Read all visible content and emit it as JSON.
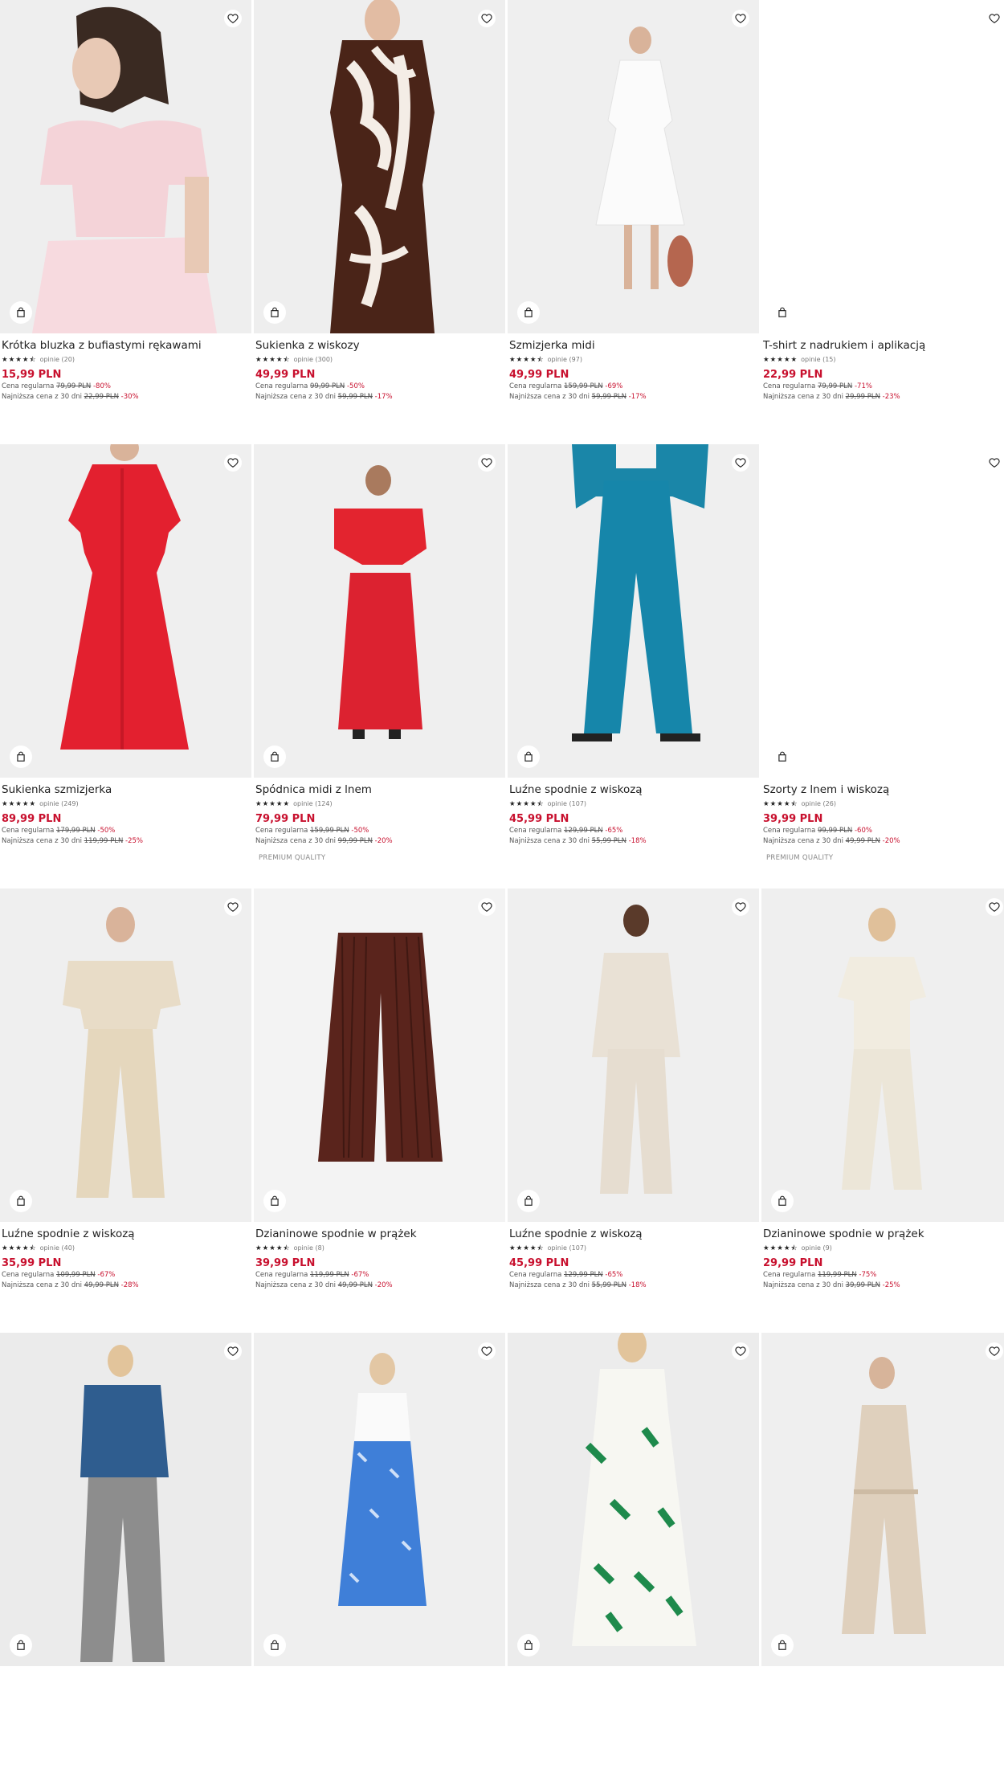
{
  "products": [
    {
      "title": "Krótka bluzka z bufiastymi rękawami",
      "stars": 4.5,
      "reviews": "opinie (20)",
      "price": "15,99 PLN",
      "regular_label": "Cena regularna",
      "regular_price": "79,99 PLN",
      "regular_discount": "-80%",
      "lowest_label": "Najniższa cena z 30 dni",
      "lowest_price": "22,99 PLN",
      "lowest_discount": "-30%",
      "premium": ""
    },
    {
      "title": "Sukienka z wiskozy",
      "stars": 4.5,
      "reviews": "opinie (300)",
      "price": "49,99 PLN",
      "regular_label": "Cena regularna",
      "regular_price": "99,99 PLN",
      "regular_discount": "-50%",
      "lowest_label": "Najniższa cena z 30 dni",
      "lowest_price": "59,99 PLN",
      "lowest_discount": "-17%",
      "premium": ""
    },
    {
      "title": "Szmizjerka midi",
      "stars": 4.5,
      "reviews": "opinie (97)",
      "price": "49,99 PLN",
      "regular_label": "Cena regularna",
      "regular_price": "159,99 PLN",
      "regular_discount": "-69%",
      "lowest_label": "Najniższa cena z 30 dni",
      "lowest_price": "59,99 PLN",
      "lowest_discount": "-17%",
      "premium": ""
    },
    {
      "title": "T-shirt z nadrukiem i aplikacją",
      "stars": 5,
      "reviews": "opinie (15)",
      "price": "22,99 PLN",
      "regular_label": "Cena regularna",
      "regular_price": "79,99 PLN",
      "regular_discount": "-71%",
      "lowest_label": "Najniższa cena z 30 dni",
      "lowest_price": "29,99 PLN",
      "lowest_discount": "-23%",
      "premium": ""
    },
    {
      "title": "Sukienka szmizjerka",
      "stars": 5,
      "reviews": "opinie (249)",
      "price": "89,99 PLN",
      "regular_label": "Cena regularna",
      "regular_price": "179,99 PLN",
      "regular_discount": "-50%",
      "lowest_label": "Najniższa cena z 30 dni",
      "lowest_price": "119,99 PLN",
      "lowest_discount": "-25%",
      "premium": ""
    },
    {
      "title": "Spódnica midi z lnem",
      "stars": 5,
      "reviews": "opinie (124)",
      "price": "79,99 PLN",
      "regular_label": "Cena regularna",
      "regular_price": "159,99 PLN",
      "regular_discount": "-50%",
      "lowest_label": "Najniższa cena z 30 dni",
      "lowest_price": "99,99 PLN",
      "lowest_discount": "-20%",
      "premium": "PREMIUM QUALITY"
    },
    {
      "title": "Luźne spodnie z wiskozą",
      "stars": 4.5,
      "reviews": "opinie (107)",
      "price": "45,99 PLN",
      "regular_label": "Cena regularna",
      "regular_price": "129,99 PLN",
      "regular_discount": "-65%",
      "lowest_label": "Najniższa cena z 30 dni",
      "lowest_price": "55,99 PLN",
      "lowest_discount": "-18%",
      "premium": ""
    },
    {
      "title": "Szorty z lnem i wiskozą",
      "stars": 4.5,
      "reviews": "opinie (26)",
      "price": "39,99 PLN",
      "regular_label": "Cena regularna",
      "regular_price": "99,99 PLN",
      "regular_discount": "-60%",
      "lowest_label": "Najniższa cena z 30 dni",
      "lowest_price": "49,99 PLN",
      "lowest_discount": "-20%",
      "premium": "PREMIUM QUALITY"
    },
    {
      "title": "Luźne spodnie z wiskozą",
      "stars": 4.5,
      "reviews": "opinie (40)",
      "price": "35,99 PLN",
      "regular_label": "Cena regularna",
      "regular_price": "109,99 PLN",
      "regular_discount": "-67%",
      "lowest_label": "Najniższa cena z 30 dni",
      "lowest_price": "49,99 PLN",
      "lowest_discount": "-28%",
      "premium": ""
    },
    {
      "title": "Dzianinowe spodnie w prążek",
      "stars": 4.5,
      "reviews": "opinie (8)",
      "price": "39,99 PLN",
      "regular_label": "Cena regularna",
      "regular_price": "119,99 PLN",
      "regular_discount": "-67%",
      "lowest_label": "Najniższa cena z 30 dni",
      "lowest_price": "49,99 PLN",
      "lowest_discount": "-20%",
      "premium": ""
    },
    {
      "title": "Luźne spodnie z wiskozą",
      "stars": 4.5,
      "reviews": "opinie (107)",
      "price": "45,99 PLN",
      "regular_label": "Cena regularna",
      "regular_price": "129,99 PLN",
      "regular_discount": "-65%",
      "lowest_label": "Najniższa cena z 30 dni",
      "lowest_price": "55,99 PLN",
      "lowest_discount": "-18%",
      "premium": ""
    },
    {
      "title": "Dzianinowe spodnie w prążek",
      "stars": 4.5,
      "reviews": "opinie (9)",
      "price": "29,99 PLN",
      "regular_label": "Cena regularna",
      "regular_price": "119,99 PLN",
      "regular_discount": "-75%",
      "lowest_label": "Najniższa cena z 30 dni",
      "lowest_price": "39,99 PLN",
      "lowest_discount": "-25%",
      "premium": ""
    },
    {
      "title": "",
      "stars": 0,
      "reviews": "",
      "price": "",
      "regular_label": "",
      "regular_price": "",
      "regular_discount": "",
      "lowest_label": "",
      "lowest_price": "",
      "lowest_discount": "",
      "premium": ""
    },
    {
      "title": "",
      "stars": 0,
      "reviews": "",
      "price": "",
      "regular_label": "",
      "regular_price": "",
      "regular_discount": "",
      "lowest_label": "",
      "lowest_price": "",
      "lowest_discount": "",
      "premium": ""
    },
    {
      "title": "",
      "stars": 0,
      "reviews": "",
      "price": "",
      "regular_label": "",
      "regular_price": "",
      "regular_discount": "",
      "lowest_label": "",
      "lowest_price": "",
      "lowest_discount": "",
      "premium": ""
    },
    {
      "title": "",
      "stars": 0,
      "reviews": "",
      "price": "",
      "regular_label": "",
      "regular_price": "",
      "regular_discount": "",
      "lowest_label": "",
      "lowest_price": "",
      "lowest_discount": "",
      "premium": ""
    }
  ],
  "icons": {
    "wishlist": "heart-icon",
    "add_to_bag": "shopping-bag-icon",
    "rating": "star-icon"
  },
  "colors": {
    "price": "#c8102e",
    "discount": "#c8102e"
  }
}
